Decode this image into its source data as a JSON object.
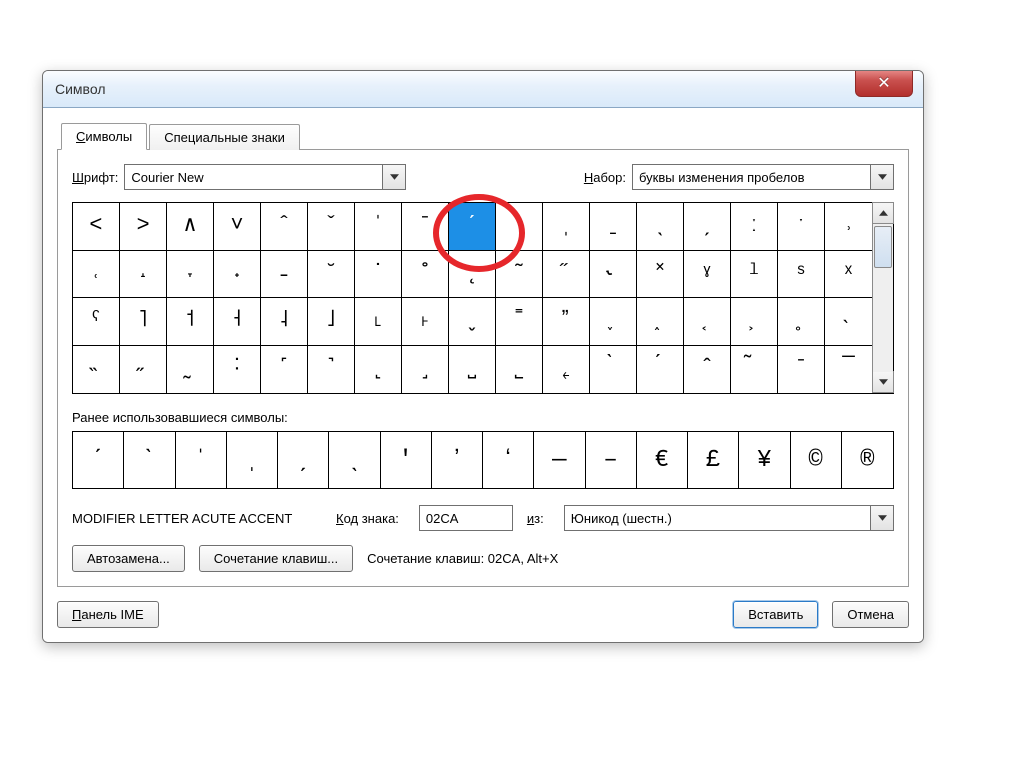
{
  "window": {
    "title": "Символ"
  },
  "close": {
    "glyph": "✕"
  },
  "tabs": [
    {
      "label": "Символы",
      "mn": "С",
      "rest": "имволы",
      "active": true
    },
    {
      "label": "Специальные знаки",
      "mn": "С",
      "rest": "пециальные знаки",
      "active": false
    }
  ],
  "font": {
    "label_mn": "Ш",
    "label": "рифт:",
    "value": "Courier New"
  },
  "subset": {
    "label_mn": "Н",
    "label": "абор:",
    "value": "буквы изменения пробелов"
  },
  "grid": {
    "selected_index": 8,
    "symbols": [
      "˂",
      "˃",
      "∧",
      "˅",
      "ˆ",
      "ˇ",
      "ˈ",
      "ˉ",
      "ˊ",
      "ˋ",
      "ˌ",
      "ˍ",
      "ˎ",
      "ˏ",
      "ː",
      "ˑ",
      "˒",
      "˓",
      "˔",
      "˕",
      "˖",
      "˗",
      "˘",
      "˙",
      "˚",
      "˛",
      "˜",
      "˝",
      "˞",
      "˟",
      "ˠ",
      "ˡ",
      "ˢ",
      "ˣ",
      "ˤ",
      "˥",
      "˦",
      "˧",
      "˨",
      "˩",
      "˪",
      "˫",
      "ˬ",
      "˭",
      "ˮ",
      "˯",
      "˰",
      "˱",
      "˲",
      "˳",
      "˴",
      "˵",
      "˶",
      "˷",
      "˸",
      "˹",
      "˺",
      "˻",
      "˼",
      "˽",
      "˾",
      "˿",
      "̀",
      "́",
      "̂",
      "̃",
      "̄",
      "̅"
    ]
  },
  "recent": {
    "label": "Ранее использовавшиеся символы:",
    "symbols": [
      "ˊ",
      "ˋ",
      "ˈ",
      "ˌ",
      "ˏ",
      "ˎ",
      "ʹ",
      "ʼ",
      "ʻ",
      "—",
      "–",
      "€",
      "£",
      "¥",
      "©",
      "®"
    ]
  },
  "desc": "MODIFIER LETTER ACUTE ACCENT",
  "code": {
    "label_mn": "К",
    "label": "од знака:",
    "value": "02CA"
  },
  "from": {
    "label_mn": "и",
    "label": "з:",
    "value": "Юникод (шестн.)"
  },
  "autocorrect": {
    "label": "Автозамена..."
  },
  "shortcut": {
    "label": "Сочетание клавиш..."
  },
  "shortcut_info": "Сочетание клавиш: 02CA, Alt+X",
  "ime": {
    "label_mn": "П",
    "label": "анель IME"
  },
  "insert": {
    "label": "Вставить"
  },
  "cancel": {
    "label": "Отмена"
  }
}
